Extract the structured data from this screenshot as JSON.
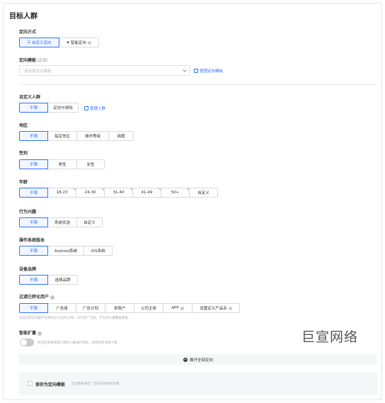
{
  "title": "目标人群",
  "targeting_mode": {
    "label": "定向方式",
    "options": [
      {
        "label": "自定义定向",
        "icon": "sliders-icon",
        "active": true
      },
      {
        "label": "智能定向",
        "icon": "eye-icon",
        "active": false,
        "has_hint": true
      }
    ]
  },
  "template": {
    "label": "定向模板",
    "optional": "(选填)",
    "placeholder": "请选择定向模板",
    "manage_link": "管理定向模板"
  },
  "custom_audience": {
    "label": "自定义人群",
    "options": [
      "不限",
      "定向与排除"
    ],
    "manage_link": "管理人群"
  },
  "region": {
    "label": "地区",
    "options": [
      "不限",
      "指定地区",
      "城市等级",
      "商圈"
    ]
  },
  "gender": {
    "label": "性别",
    "options": [
      "不限",
      "男性",
      "女性"
    ]
  },
  "age": {
    "label": "年龄",
    "options": [
      "不限",
      "18-23",
      "24-30",
      "31-40",
      "41-49",
      "50+",
      "自定义"
    ]
  },
  "behavior": {
    "label": "行为兴趣",
    "options": [
      "不限",
      "系统优选",
      "自定义"
    ]
  },
  "os": {
    "label": "操作系统版本",
    "options": [
      "不限",
      "Android系统",
      "iOS系统"
    ]
  },
  "device_brand": {
    "label": "设备品牌",
    "options": [
      "不限",
      "选择品牌"
    ]
  },
  "filter_converted": {
    "label": "过滤已转化用户",
    "options": [
      "不限",
      "广告组",
      "广告计划",
      "本账户",
      "公司主体",
      "APP",
      "设置定义产品名"
    ],
    "note": "过滤已转化功能不支持出价方式为CPM、CPC的广告组，不支持人群覆盖预估"
  },
  "smart_expand": {
    "label": "智能扩量",
    "description": "开启后系统将基于目标人群进行探索，获得更多优质人群"
  },
  "expand_all": "展开全部定向",
  "save_template": {
    "label": "保存为定向模板",
    "hint": "定向模板将在广告操作保存时创建"
  },
  "watermark": "巨宣网络",
  "colors": {
    "accent": "#3370ff",
    "border": "#d9d9d9",
    "bar_bg": "#f5f6f8"
  }
}
